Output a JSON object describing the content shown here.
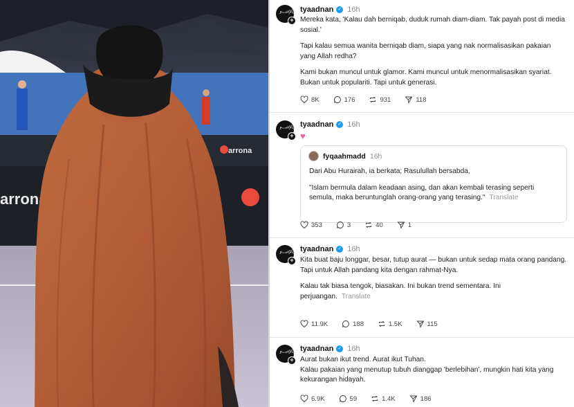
{
  "photo": {
    "description_icon": "woman-in-niqab-photo",
    "signs": [
      "arronax",
      "arrona",
      "arronax"
    ]
  },
  "posts": [
    {
      "username": "tyaadnan",
      "time": "16h",
      "paragraphs": [
        "Mereka kata, 'Kalau dah berniqab, duduk rumah diam-diam. Tak payah post di media sosial.'",
        "Tapi kalau semua wanita berniqab diam, siapa yang nak normalisasikan pakaian yang Allah redha?",
        "Kami bukan muncul untuk glamor. Kami muncul untuk menormalisasikan syariat. Bukan untuk populariti. Tapi untuk generasi."
      ],
      "likes": "8K",
      "replies": "176",
      "reposts": "931",
      "shares": "118"
    },
    {
      "username": "tyaadnan",
      "time": "16h",
      "emoji": "♥",
      "quote": {
        "username": "fyqaahmadd",
        "time": "16h",
        "line1": "Dari Abu Hurairah, ia berkata; Rasulullah bersabda,",
        "line2": "\"Islam bermula dalam keadaan asing, dan akan kembali terasing seperti semula, maka beruntunglah orang-orang yang terasing.\"",
        "translate": "Translate"
      },
      "likes": "353",
      "replies": "3",
      "reposts": "40",
      "shares": "1"
    },
    {
      "username": "tyaadnan",
      "time": "16h",
      "paragraph1": "Kita buat baju longgar, besar, tutup aurat — bukan untuk sedap mata orang pandang.",
      "paragraph2": "Tapi untuk Allah pandang kita dengan rahmat-Nya.",
      "paragraph3": "Kalau tak biasa tengok, biasakan. Ini bukan trend sementara. Ini perjuangan.",
      "translate": "Translate",
      "likes": "11.9K",
      "replies": "188",
      "reposts": "1.5K",
      "shares": "115"
    },
    {
      "username": "tyaadnan",
      "time": "16h",
      "paragraph1": "Aurat bukan ikut trend. Aurat ikut Tuhan.",
      "paragraph2": "Kalau pakaian yang menutup tubuh dianggap 'berlebihan', mungkin hati kita yang kekurangan hidayah.",
      "likes": "6.9K",
      "replies": "59",
      "reposts": "1.4K",
      "shares": "186"
    }
  ],
  "colors": {
    "verified": "#1d9bf0",
    "abaya": "#b8623c",
    "muted": "#8e8e8e"
  }
}
